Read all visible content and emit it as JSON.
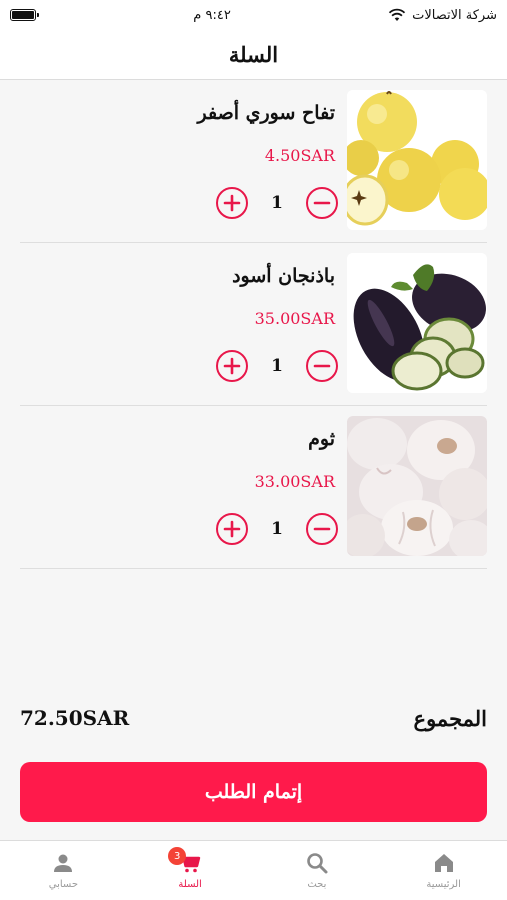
{
  "status_bar": {
    "carrier": "شركة الاتصالات",
    "time": "٩:٤٢ م"
  },
  "header": {
    "title": "السلة"
  },
  "cart": {
    "items": [
      {
        "name": "تفاح سوري أصفر",
        "price": "4.50SAR",
        "quantity": "1",
        "image": "yellow-apples"
      },
      {
        "name": "باذنجان أسود",
        "price": "35.00SAR",
        "quantity": "1",
        "image": "eggplant"
      },
      {
        "name": "ثوم",
        "price": "33.00SAR",
        "quantity": "1",
        "image": "garlic"
      }
    ],
    "total_label": "المجموع",
    "total_amount": "72.50SAR",
    "checkout_label": "إتمام الطلب"
  },
  "tab_bar": {
    "items": [
      {
        "label": "الرئيسية",
        "icon": "home-icon"
      },
      {
        "label": "بحث",
        "icon": "search-icon"
      },
      {
        "label": "السلة",
        "icon": "cart-icon",
        "badge": "3",
        "active": true
      },
      {
        "label": "حسابي",
        "icon": "person-icon"
      }
    ]
  },
  "colors": {
    "accent": "#e8174a",
    "checkout": "#ff1a4b",
    "badge": "#f44336"
  }
}
